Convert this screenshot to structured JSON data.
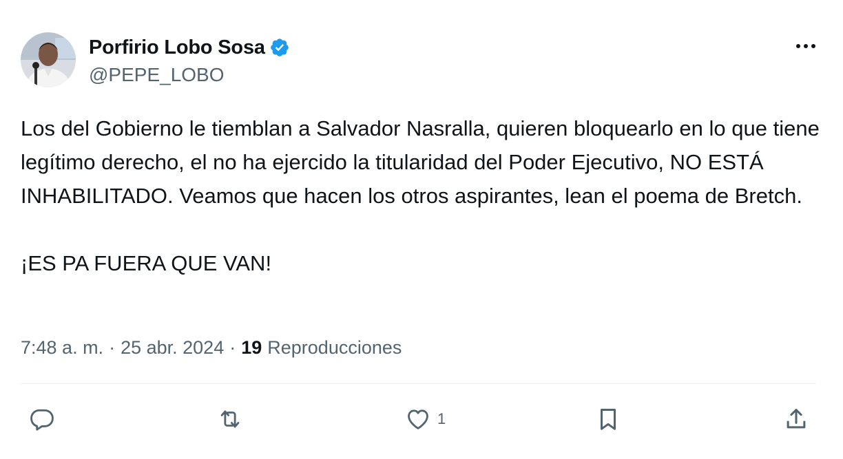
{
  "tweet": {
    "author": {
      "display_name": "Porfirio Lobo Sosa",
      "handle": "@PEPE_LOBO",
      "verified": true,
      "verified_color": "#1d9bf0"
    },
    "paragraphs": [
      "Los del Gobierno le tiemblan a Salvador Nasralla, quieren bloquearlo en lo que tiene legítimo derecho, el no ha ejercido la titularidad del Poder Ejecutivo, NO ESTÁ INHABILITADO. Veamos que hacen los otros aspirantes, lean el poema de Bretch.",
      "¡ES PA FUERA QUE VAN!"
    ],
    "meta": {
      "time": "7:48 a. m.",
      "separator": "·",
      "date": "25 abr. 2024",
      "views_count": "19",
      "views_label": "Reproducciones"
    },
    "actions": {
      "reply": {
        "icon": "reply-icon",
        "count": ""
      },
      "repost": {
        "icon": "repost-icon",
        "count": ""
      },
      "like": {
        "icon": "heart-icon",
        "count": "1"
      },
      "bookmark": {
        "icon": "bookmark-icon",
        "count": ""
      },
      "share": {
        "icon": "share-icon",
        "count": ""
      }
    }
  },
  "colors": {
    "text_primary": "#0f1419",
    "text_secondary": "#536471",
    "divider": "#eff3f4",
    "accent": "#1d9bf0"
  }
}
